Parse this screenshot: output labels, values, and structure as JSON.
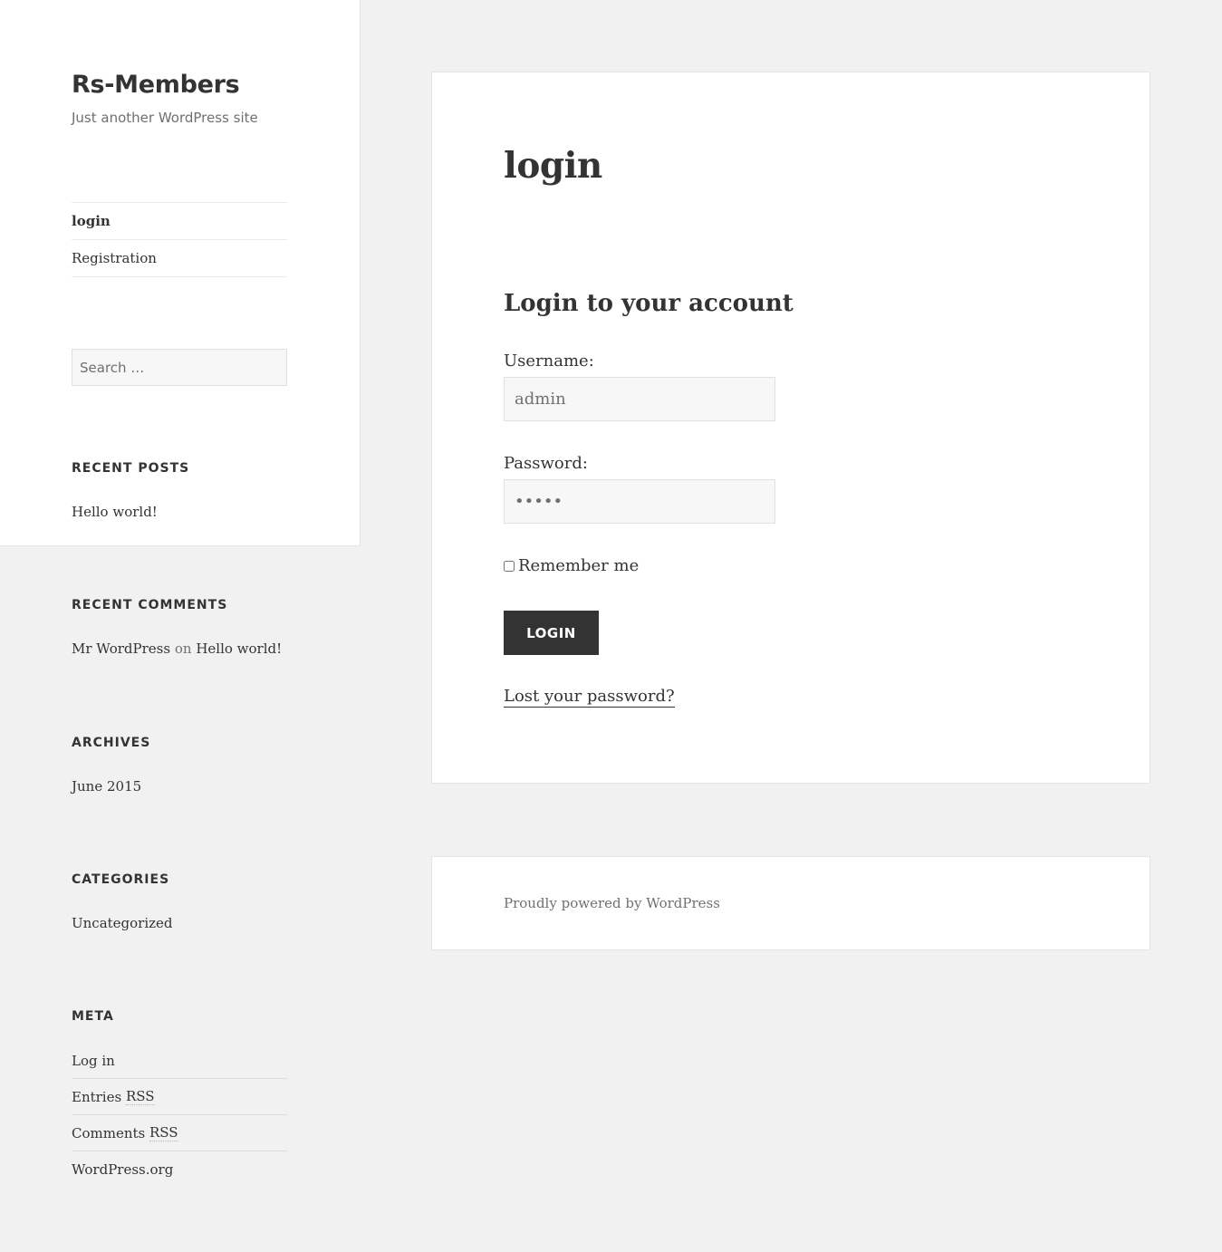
{
  "site": {
    "title": "Rs-Members",
    "description": "Just another WordPress site"
  },
  "nav": {
    "items": [
      {
        "label": "login",
        "current": true
      },
      {
        "label": "Registration",
        "current": false
      }
    ]
  },
  "search": {
    "placeholder": "Search …",
    "value": ""
  },
  "widgets": {
    "recent_posts": {
      "title": "RECENT POSTS",
      "items": [
        "Hello world!"
      ]
    },
    "recent_comments": {
      "title": "RECENT COMMENTS",
      "author": "Mr WordPress",
      "connector": "on",
      "post": "Hello world!"
    },
    "archives": {
      "title": "ARCHIVES",
      "items": [
        "June 2015"
      ]
    },
    "categories": {
      "title": "CATEGORIES",
      "items": [
        "Uncategorized"
      ]
    },
    "meta": {
      "title": "META",
      "items": [
        {
          "label": "Log in"
        },
        {
          "label": "Entries",
          "abbr": "RSS"
        },
        {
          "label": "Comments",
          "abbr": "RSS"
        },
        {
          "label": "WordPress.org"
        }
      ]
    }
  },
  "main": {
    "page_title": "login",
    "form": {
      "heading": "Login to your account",
      "username_label": "Username:",
      "username_value": "admin",
      "password_label": "Password:",
      "password_value": "•••••",
      "remember_label": "Remember me",
      "remember_checked": false,
      "submit_label": "LOGIN",
      "lost_password": "Lost your password?"
    }
  },
  "footer": {
    "credit": "Proudly powered by WordPress"
  },
  "colors": {
    "background": "#f1f1f1",
    "panel": "#ffffff",
    "text": "#333333",
    "muted": "#707070",
    "button": "#333333",
    "field_bg": "#f7f7f7"
  }
}
